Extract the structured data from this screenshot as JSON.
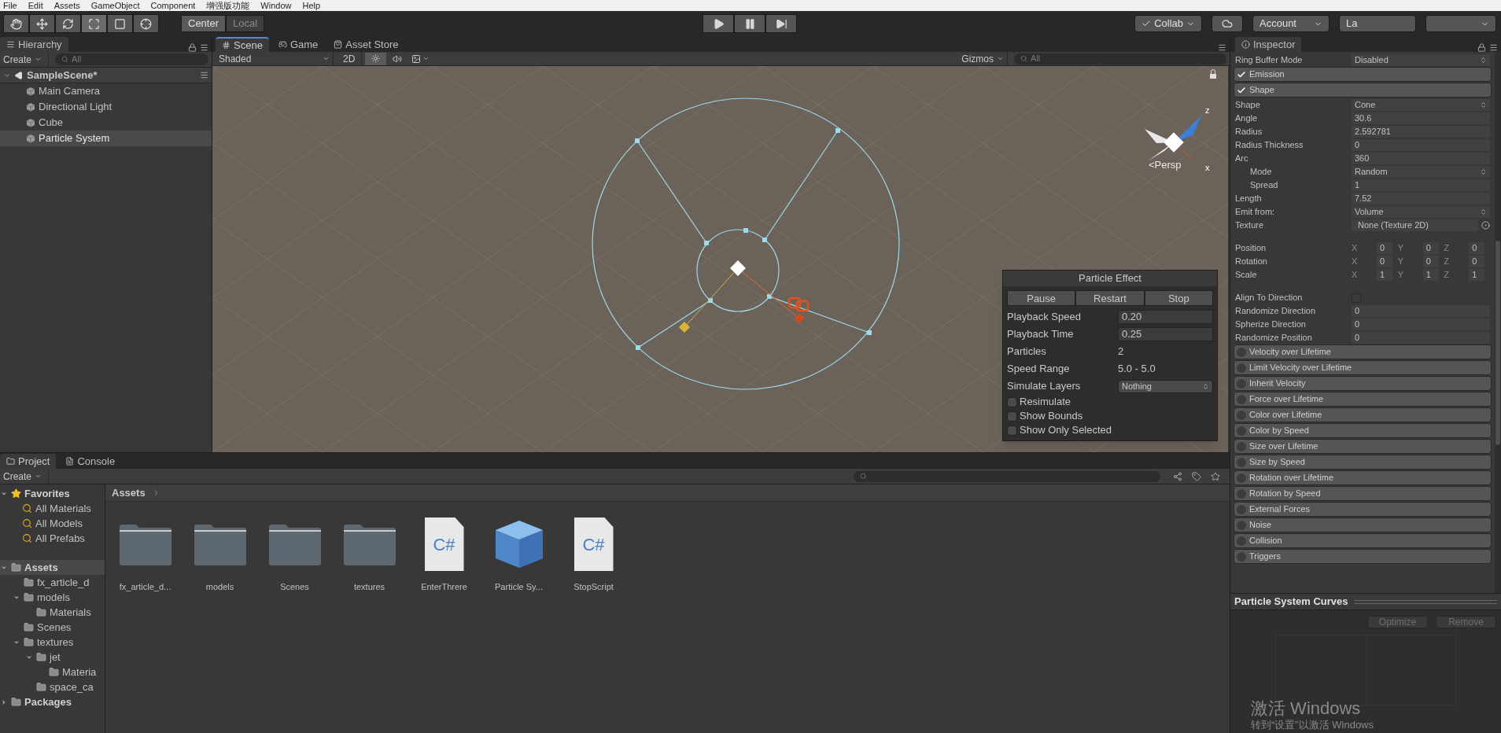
{
  "menu_bar": [
    "File",
    "Edit",
    "Assets",
    "GameObject",
    "Component",
    "增强版功能",
    "Window",
    "Help"
  ],
  "toolbar": {
    "tools": [
      {
        "kind": "hand",
        "selected": false
      },
      {
        "kind": "move",
        "selected": false
      },
      {
        "kind": "rotate",
        "selected": false
      },
      {
        "kind": "scale",
        "selected": true
      },
      {
        "kind": "rect",
        "selected": false
      },
      {
        "kind": "transform",
        "selected": false
      }
    ],
    "pivot": [
      {
        "label": "Center",
        "selected": true
      },
      {
        "label": "Local",
        "selected": false
      }
    ],
    "playback": [
      {
        "kind": "play"
      },
      {
        "kind": "pause"
      },
      {
        "kind": "step"
      }
    ],
    "collab": "Collab",
    "account": "Account",
    "layers": "La"
  },
  "hierarchy": {
    "tab": "Hierarchy",
    "create": "Create",
    "search_placeholder": "All",
    "scene": "SampleScene*",
    "objects": [
      {
        "name": "Main Camera",
        "selected": false
      },
      {
        "name": "Directional Light",
        "selected": false
      },
      {
        "name": "Cube",
        "selected": false
      },
      {
        "name": "Particle System",
        "selected": true
      }
    ]
  },
  "scene_view": {
    "tabs": [
      {
        "label": "Scene",
        "kind": "scene",
        "selected": true
      },
      {
        "label": "Game",
        "kind": "game",
        "selected": false
      },
      {
        "label": "Asset Store",
        "kind": "store",
        "selected": false
      }
    ],
    "shading": "Shaded",
    "mode_2d": "2D",
    "lighting_on": true,
    "audio_on": false,
    "gizmos": "Gizmos",
    "search_placeholder": "All",
    "projection": "<Persp",
    "axis_labels": [
      "z",
      "x"
    ],
    "particle_effect": {
      "title": "Particle Effect",
      "buttons": [
        "Pause",
        "Restart",
        "Stop"
      ],
      "rows": [
        {
          "kind": "field",
          "label": "Playback Speed",
          "value": "0.20"
        },
        {
          "kind": "field",
          "label": "Playback Time",
          "value": "0.25"
        },
        {
          "kind": "text",
          "label": "Particles",
          "value": "2"
        },
        {
          "kind": "text",
          "label": "Speed Range",
          "value": "5.0 - 5.0"
        },
        {
          "kind": "dropdown",
          "label": "Simulate Layers",
          "value": "Nothing"
        }
      ],
      "toggles": [
        {
          "label": "Resimulate",
          "checked": false
        },
        {
          "label": "Show Bounds",
          "checked": false
        },
        {
          "label": "Show Only Selected",
          "checked": false
        }
      ]
    }
  },
  "inspector": {
    "tab": "Inspector",
    "rows": [
      {
        "kind": "dropdown",
        "label": "Ring Buffer Mode",
        "value": "Disabled"
      },
      {
        "kind": "module",
        "label": "Emission",
        "checked": true
      },
      {
        "kind": "module",
        "label": "Shape",
        "checked": true
      },
      {
        "kind": "dropdown",
        "label": "Shape",
        "value": "Cone"
      },
      {
        "kind": "field",
        "label": "Angle",
        "value": "30.6"
      },
      {
        "kind": "field",
        "label": "Radius",
        "value": "2.592781"
      },
      {
        "kind": "field",
        "label": "Radius Thickness",
        "value": "0"
      },
      {
        "kind": "field",
        "label": "Arc",
        "value": "360",
        "children": [
          {
            "kind": "dropdown",
            "label": "Mode",
            "value": "Random"
          },
          {
            "kind": "field",
            "label": "Spread",
            "value": "1"
          }
        ]
      },
      {
        "kind": "field",
        "label": "Length",
        "value": "7.52"
      },
      {
        "kind": "dropdown",
        "label": "Emit from:",
        "value": "Volume"
      },
      {
        "kind": "object",
        "label": "Texture",
        "value": "None (Texture 2D)"
      },
      {
        "kind": "vector",
        "label": "Position",
        "values": [
          {
            "axis": "X",
            "value": "0"
          },
          {
            "axis": "Y",
            "value": "0"
          },
          {
            "axis": "Z",
            "value": "0"
          }
        ]
      },
      {
        "kind": "vector",
        "label": "Rotation",
        "values": [
          {
            "axis": "X",
            "value": "0"
          },
          {
            "axis": "Y",
            "value": "0"
          },
          {
            "axis": "Z",
            "value": "0"
          }
        ]
      },
      {
        "kind": "vector",
        "label": "Scale",
        "values": [
          {
            "axis": "X",
            "value": "1"
          },
          {
            "axis": "Y",
            "value": "1"
          },
          {
            "axis": "Z",
            "value": "1"
          }
        ]
      },
      {
        "kind": "checkbox",
        "label": "Align To Direction",
        "checked": false
      },
      {
        "kind": "field",
        "label": "Randomize Direction",
        "value": "0"
      },
      {
        "kind": "field",
        "label": "Spherize Direction",
        "value": "0"
      },
      {
        "kind": "field",
        "label": "Randomize Position",
        "value": "0"
      },
      {
        "kind": "module",
        "label": "Velocity over Lifetime",
        "checked": false
      },
      {
        "kind": "module",
        "label": "Limit Velocity over Lifetime",
        "checked": false
      },
      {
        "kind": "module",
        "label": "Inherit Velocity",
        "checked": false
      },
      {
        "kind": "module",
        "label": "Force over Lifetime",
        "checked": false
      },
      {
        "kind": "module",
        "label": "Color over Lifetime",
        "checked": false
      },
      {
        "kind": "module",
        "label": "Color by Speed",
        "checked": false
      },
      {
        "kind": "module",
        "label": "Size over Lifetime",
        "checked": false
      },
      {
        "kind": "module",
        "label": "Size by Speed",
        "checked": false
      },
      {
        "kind": "module",
        "label": "Rotation over Lifetime",
        "checked": false
      },
      {
        "kind": "module",
        "label": "Rotation by Speed",
        "checked": false
      },
      {
        "kind": "module",
        "label": "External Forces",
        "checked": false
      },
      {
        "kind": "module",
        "label": "Noise",
        "checked": false
      },
      {
        "kind": "module",
        "label": "Collision",
        "checked": false
      },
      {
        "kind": "module",
        "label": "Triggers",
        "checked": false
      }
    ]
  },
  "curves": {
    "title": "Particle System Curves",
    "buttons": [
      {
        "label": "Optimize",
        "disabled": true
      },
      {
        "label": "Remove",
        "disabled": true
      }
    ]
  },
  "project": {
    "tabs": [
      {
        "label": "Project",
        "kind": "folder",
        "selected": true
      },
      {
        "label": "Console",
        "kind": "console",
        "selected": false
      }
    ],
    "create": "Create",
    "favorites": {
      "label": "Favorites",
      "items": [
        "All Materials",
        "All Models",
        "All Prefabs"
      ]
    },
    "tree": [
      {
        "name": "Assets",
        "expanded": true,
        "selected": true,
        "children": [
          {
            "name": "fx_article_d",
            "selected": false
          },
          {
            "name": "models",
            "expanded": true,
            "selected": false,
            "children": [
              {
                "name": "Materials",
                "selected": false
              }
            ]
          },
          {
            "name": "Scenes",
            "selected": false
          },
          {
            "name": "textures",
            "expanded": true,
            "selected": false,
            "children": [
              {
                "name": "jet",
                "expanded": true,
                "selected": false,
                "children": [
                  {
                    "name": "Materia",
                    "selected": false
                  }
                ]
              },
              {
                "name": "space_ca",
                "selected": false
              }
            ]
          }
        ]
      },
      {
        "name": "Packages",
        "expanded": false,
        "selected": false
      }
    ],
    "breadcrumb": "Assets",
    "assets": [
      {
        "kind": "folder",
        "name": "fx_article_d..."
      },
      {
        "kind": "folder",
        "name": "models"
      },
      {
        "kind": "folder",
        "name": "Scenes"
      },
      {
        "kind": "folder",
        "name": "textures"
      },
      {
        "kind": "script",
        "name": "EnterThrere",
        "glyph": "C#"
      },
      {
        "kind": "prefab",
        "name": "Particle Sy..."
      },
      {
        "kind": "script",
        "name": "StopScript",
        "glyph": "C#"
      }
    ]
  },
  "activation": [
    "激活 Windows",
    "转到“设置”以激活 Windows"
  ]
}
